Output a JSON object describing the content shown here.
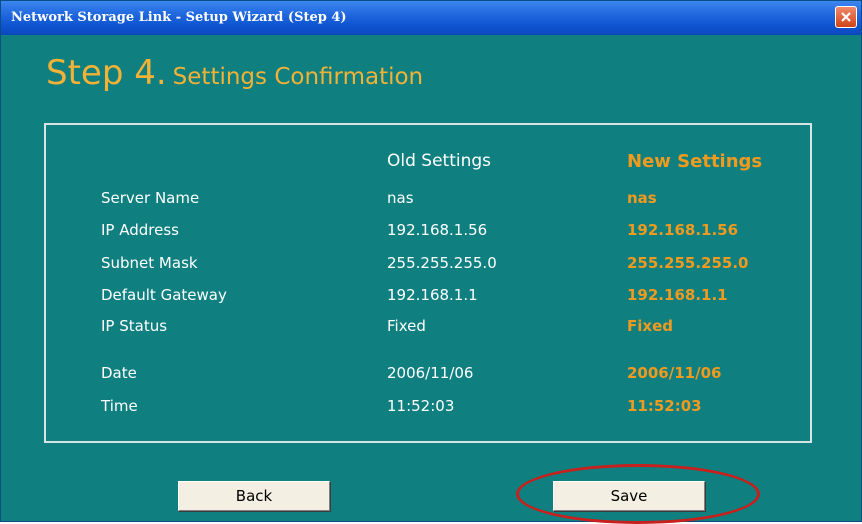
{
  "window": {
    "title": "Network Storage Link - Setup Wizard (Step 4)"
  },
  "header": {
    "step": "Step 4.",
    "subtitle": "Settings Confirmation"
  },
  "columns": {
    "old": "Old Settings",
    "new": "New Settings"
  },
  "settings": [
    {
      "label": "Server Name",
      "old": "nas",
      "new": "nas"
    },
    {
      "label": "IP Address",
      "old": "192.168.1.56",
      "new": "192.168.1.56"
    },
    {
      "label": "Subnet Mask",
      "old": "255.255.255.0",
      "new": "255.255.255.0"
    },
    {
      "label": "Default Gateway",
      "old": "192.168.1.1",
      "new": "192.168.1.1"
    },
    {
      "label": "IP Status",
      "old": "Fixed",
      "new": "Fixed"
    },
    {
      "label": "Date",
      "old": "2006/11/06",
      "new": "2006/11/06"
    },
    {
      "label": "Time",
      "old": "11:52:03",
      "new": "11:52:03"
    }
  ],
  "buttons": {
    "back": "Back",
    "save": "Save"
  },
  "colors": {
    "background": "#0f7f80",
    "accent_orange": "#f09a1e",
    "title_orange": "#f2b236",
    "highlight_red": "#c8201c"
  },
  "icons": {
    "close": "close-icon"
  }
}
